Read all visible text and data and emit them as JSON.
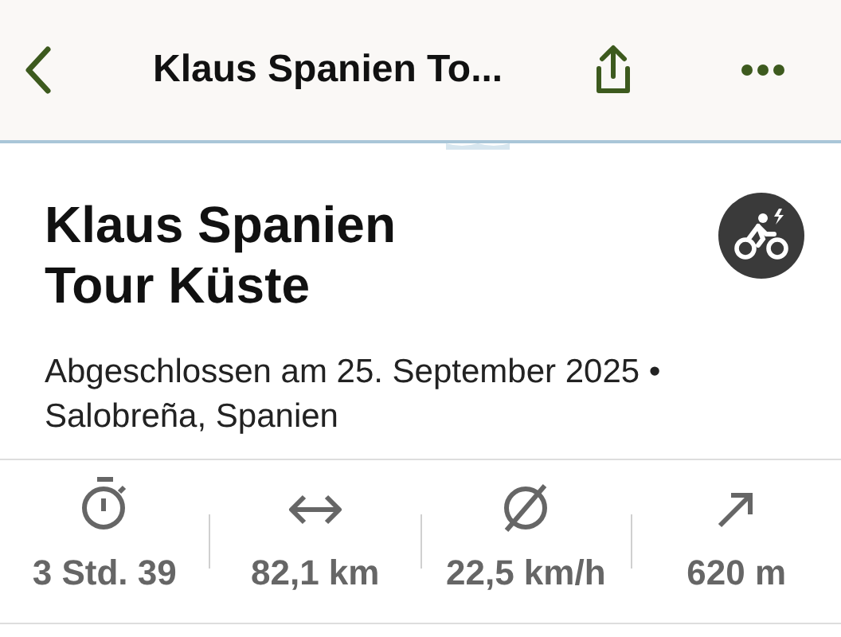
{
  "nav_bar": {
    "title": "Klaus Spanien To..."
  },
  "tour": {
    "title": "Klaus Spanien Tour Küste",
    "subtitle": "Abgeschlossen am 25. September 2025 • Salobreña, Spanien",
    "sport_icon": {
      "kind": "e-bike"
    }
  },
  "stats": [
    {
      "kind": "duration",
      "value": "3 Std. 39"
    },
    {
      "kind": "distance",
      "value": "82,1 km"
    },
    {
      "kind": "speed",
      "value": "22,5 km/h"
    },
    {
      "kind": "elevation",
      "value": "620 m"
    }
  ]
}
